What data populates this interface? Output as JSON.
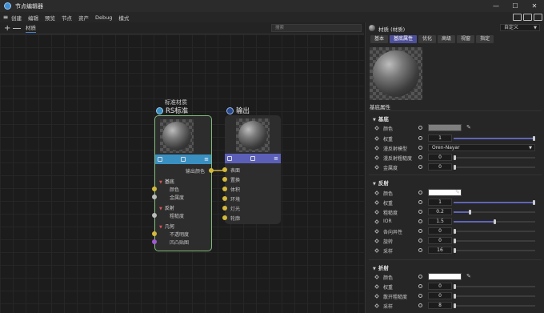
{
  "window": {
    "title": "节点编辑器",
    "minimize": "—",
    "maximize": "☐",
    "close": "✕"
  },
  "menu": [
    "创建",
    "编辑",
    "预览",
    "节点",
    "资产",
    "Debug",
    "模式"
  ],
  "graph_toolbar": {
    "add": "+",
    "tab": "材质",
    "search_placeholder": "搜索"
  },
  "material_node": {
    "label": "标准材质",
    "title": "RS标准",
    "output_port": "输出颜色",
    "groups": [
      {
        "name": "基底",
        "ports": [
          "颜色",
          "金属度"
        ]
      },
      {
        "name": "反射",
        "ports": [
          "粗糙度"
        ]
      },
      {
        "name": "几何",
        "ports": [
          "不透明度",
          "凹凸贴图"
        ]
      }
    ]
  },
  "output_node": {
    "title": "输出",
    "ports": [
      "表面",
      "置换",
      "体积",
      "环境",
      "灯光",
      "轮廓"
    ]
  },
  "panel": {
    "header": "材质 (材质)",
    "preset": "自定义",
    "tabs": [
      {
        "label": "基本",
        "active": false
      },
      {
        "label": "基底属性",
        "active": true
      },
      {
        "label": "优化",
        "active": false
      },
      {
        "label": "高级",
        "active": false
      },
      {
        "label": "视窗",
        "active": false
      },
      {
        "label": "指定",
        "active": false
      }
    ],
    "section_title": "基底属性",
    "sections": [
      {
        "title": "基底",
        "rows": [
          {
            "label": "颜色",
            "type": "color",
            "color": "#7f7f7f"
          },
          {
            "label": "权重",
            "type": "slider",
            "value": "1",
            "fraction": 1.0
          },
          {
            "label": "漫反射模型",
            "type": "dropdown",
            "value": "Oren-Nayar"
          },
          {
            "label": "漫反射粗糙度",
            "type": "number",
            "value": "0"
          },
          {
            "label": "金属度",
            "type": "number",
            "value": "0"
          }
        ]
      },
      {
        "title": "反射",
        "rows": [
          {
            "label": "颜色",
            "type": "color",
            "color": "#ffffff"
          },
          {
            "label": "权重",
            "type": "slider",
            "value": "1",
            "fraction": 1.0
          },
          {
            "label": "粗糙度",
            "type": "slider",
            "value": "0.2",
            "fraction": 0.2
          },
          {
            "label": "IOR",
            "type": "slider",
            "value": "1.5",
            "fraction": 0.5
          },
          {
            "label": "各向异性",
            "type": "slider",
            "value": "0",
            "fraction": 0.0
          },
          {
            "label": "旋转",
            "type": "slider",
            "value": "0",
            "fraction": 0.0
          },
          {
            "label": "采样",
            "type": "slider",
            "value": "16",
            "fraction": 0.0
          }
        ]
      },
      {
        "title": "折射",
        "rows": [
          {
            "label": "颜色",
            "type": "color",
            "color": "#ffffff"
          },
          {
            "label": "权重",
            "type": "slider",
            "value": "0",
            "fraction": 0.0
          },
          {
            "label": "散开粗糙度",
            "type": "slider",
            "value": "0",
            "fraction": 0.0
          },
          {
            "label": "采样",
            "type": "slider",
            "value": "8",
            "fraction": 0.0
          }
        ]
      }
    ]
  },
  "colors": {
    "accent": "#5f64b7",
    "node_selected": "#7fb87a",
    "material_bar": "#3a8fc1",
    "output_bar": "#5b5fb8"
  }
}
